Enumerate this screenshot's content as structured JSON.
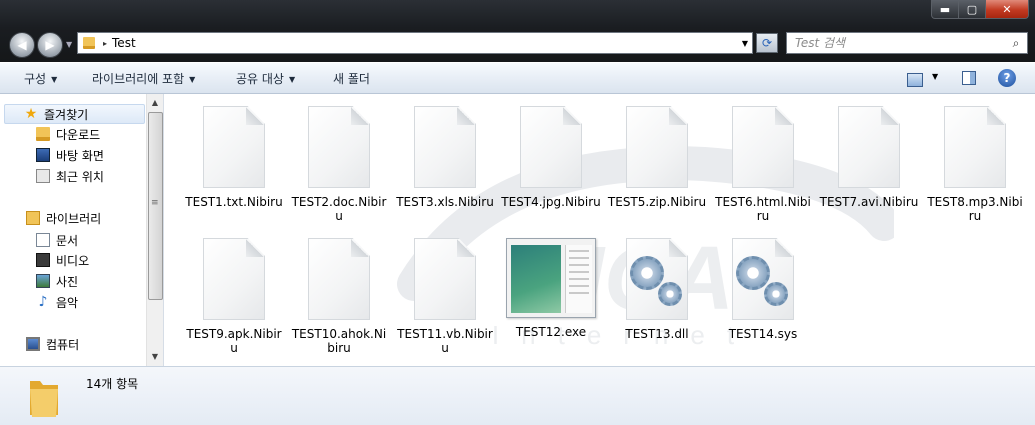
{
  "window": {
    "min_glyph": "▬",
    "max_glyph": "▢",
    "close_glyph": "✕"
  },
  "address": {
    "path": "Test",
    "separator": "▸"
  },
  "search": {
    "placeholder": "Test 검색"
  },
  "toolbar": {
    "organize": "구성",
    "include_library": "라이브러리에 포함",
    "share": "공유 대상",
    "new_folder": "새 폴더",
    "help": "?"
  },
  "nav": {
    "favorites": "즐겨찾기",
    "downloads": "다운로드",
    "desktop": "바탕 화면",
    "recent": "최근 위치",
    "libraries": "라이브러리",
    "documents": "문서",
    "videos": "비디오",
    "pictures": "사진",
    "music": "음악",
    "computer": "컴퓨터"
  },
  "files": [
    {
      "name": "TEST1.txt.Nibiru",
      "icon": "blank-file-icon"
    },
    {
      "name": "TEST2.doc.Nibiru",
      "icon": "blank-file-icon"
    },
    {
      "name": "TEST3.xls.Nibiru",
      "icon": "blank-file-icon"
    },
    {
      "name": "TEST4.jpg.Nibiru",
      "icon": "blank-file-icon"
    },
    {
      "name": "TEST5.zip.Nibiru",
      "icon": "blank-file-icon"
    },
    {
      "name": "TEST6.html.Nibiru",
      "icon": "blank-file-icon"
    },
    {
      "name": "TEST7.avi.Nibiru",
      "icon": "blank-file-icon"
    },
    {
      "name": "TEST8.mp3.Nibiru",
      "icon": "blank-file-icon"
    },
    {
      "name": "TEST9.apk.Nibiru",
      "icon": "blank-file-icon"
    },
    {
      "name": "TEST10.ahok.Nibiru",
      "icon": "blank-file-icon"
    },
    {
      "name": "TEST11.vb.Nibiru",
      "icon": "blank-file-icon"
    },
    {
      "name": "TEST12.exe",
      "icon": "exe-thumbnail-icon"
    },
    {
      "name": "TEST13.dll",
      "icon": "gear-file-icon"
    },
    {
      "name": "TEST14.sys",
      "icon": "gear-file-icon"
    }
  ],
  "status": {
    "item_count": "14개 항목"
  }
}
